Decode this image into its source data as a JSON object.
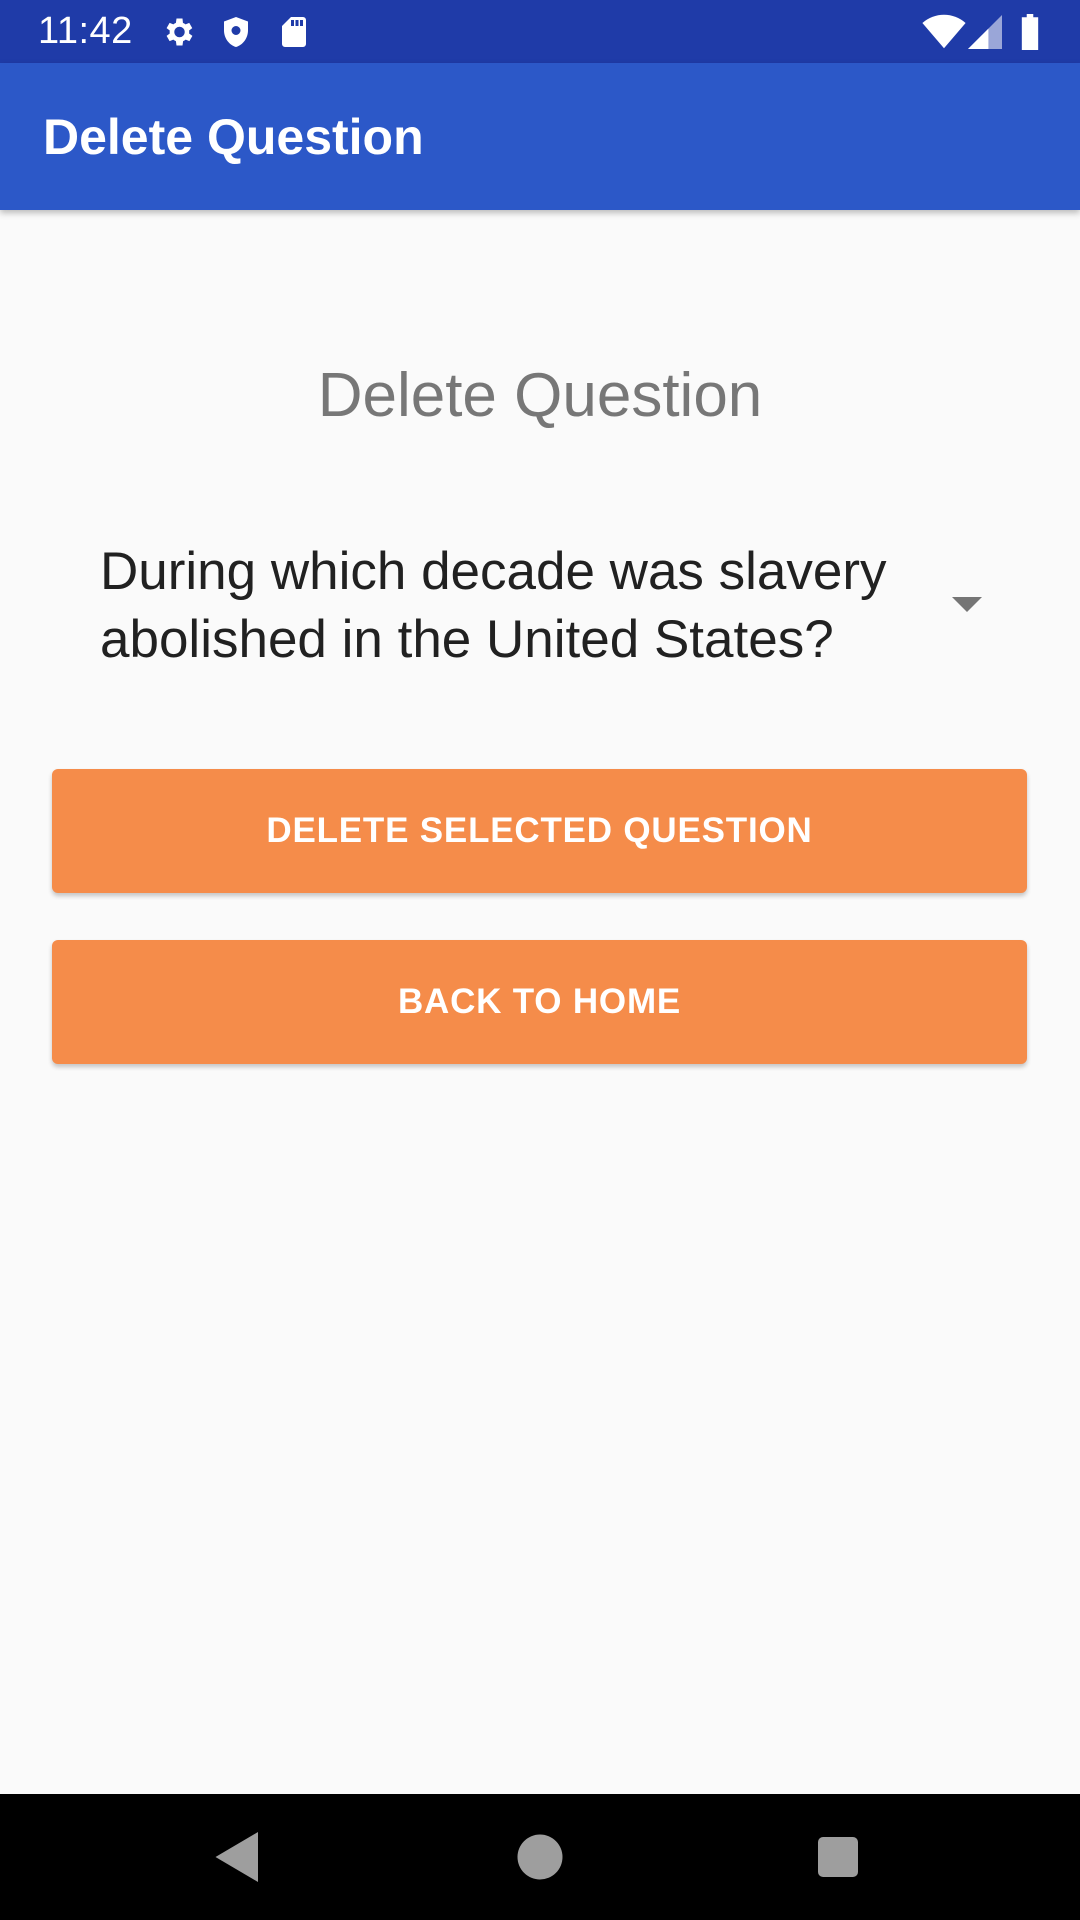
{
  "status_bar": {
    "time": "11:42",
    "icons": [
      "gear-icon",
      "shield-icon",
      "sd-card-icon",
      "wifi-icon",
      "signal-icon",
      "battery-icon"
    ]
  },
  "app_bar": {
    "title": "Delete Question"
  },
  "main": {
    "heading": "Delete Question",
    "question_spinner": {
      "selected_value": "During which decade was slavery abolished in the United States?"
    },
    "delete_button_label": "DELETE SELECTED QUESTION",
    "home_button_label": "BACK TO HOME"
  },
  "nav_bar": {
    "icons": [
      "back-icon",
      "home-icon",
      "recents-icon"
    ]
  },
  "colors": {
    "status_bar": "#1f3ba8",
    "app_bar": "#2c58c8",
    "button": "#f58c4a",
    "background": "#fafafa"
  }
}
